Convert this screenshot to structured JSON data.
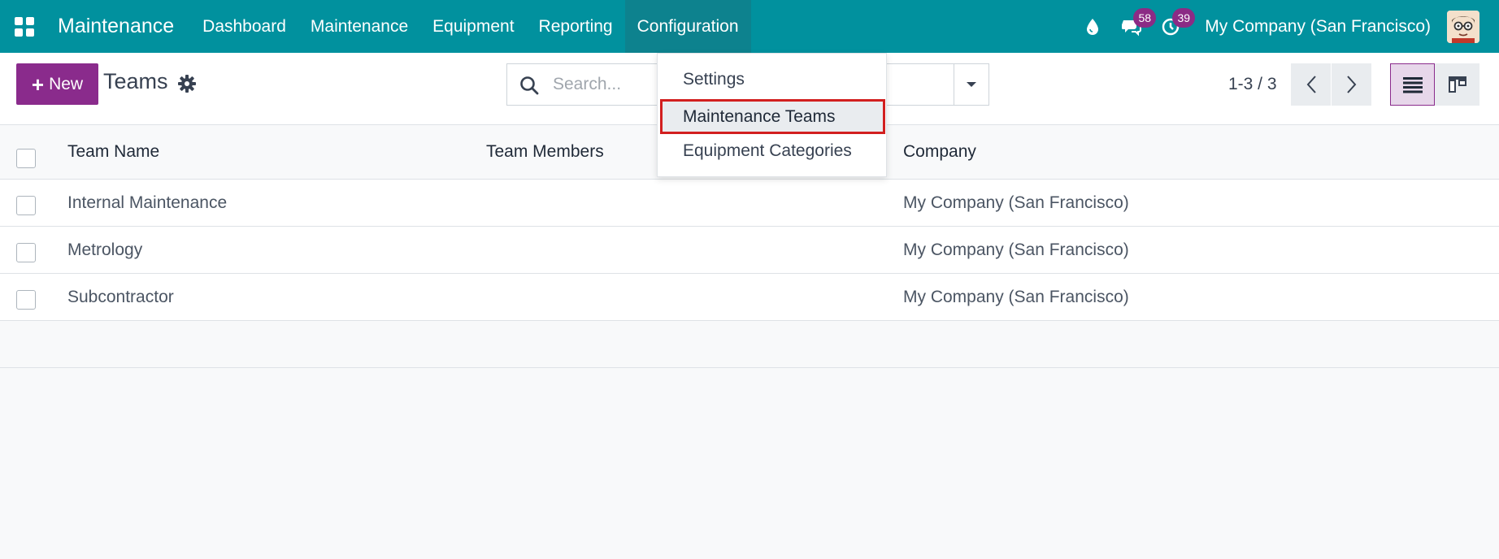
{
  "navbar": {
    "app_name": "Maintenance",
    "menu": [
      "Dashboard",
      "Maintenance",
      "Equipment",
      "Reporting",
      "Configuration"
    ],
    "active_menu": "Configuration",
    "messages_count": "58",
    "activities_count": "39",
    "company": "My Company (San Francisco)",
    "accent_color": "#01919e"
  },
  "control_panel": {
    "new_label": "New",
    "title": "Teams",
    "search_placeholder": "Search...",
    "pager": "1-3 / 3",
    "brand_color": "#8a2b8c"
  },
  "configuration_dropdown": {
    "items": [
      "Settings",
      "Maintenance Teams",
      "Equipment Categories"
    ],
    "highlighted": "Maintenance Teams"
  },
  "table": {
    "columns": [
      "Team Name",
      "Team Members",
      "Company"
    ],
    "rows": [
      {
        "team_name": "Internal Maintenance",
        "team_members": "",
        "company": "My Company (San Francisco)"
      },
      {
        "team_name": "Metrology",
        "team_members": "",
        "company": "My Company (San Francisco)"
      },
      {
        "team_name": "Subcontractor",
        "team_members": "",
        "company": "My Company (San Francisco)"
      }
    ]
  }
}
